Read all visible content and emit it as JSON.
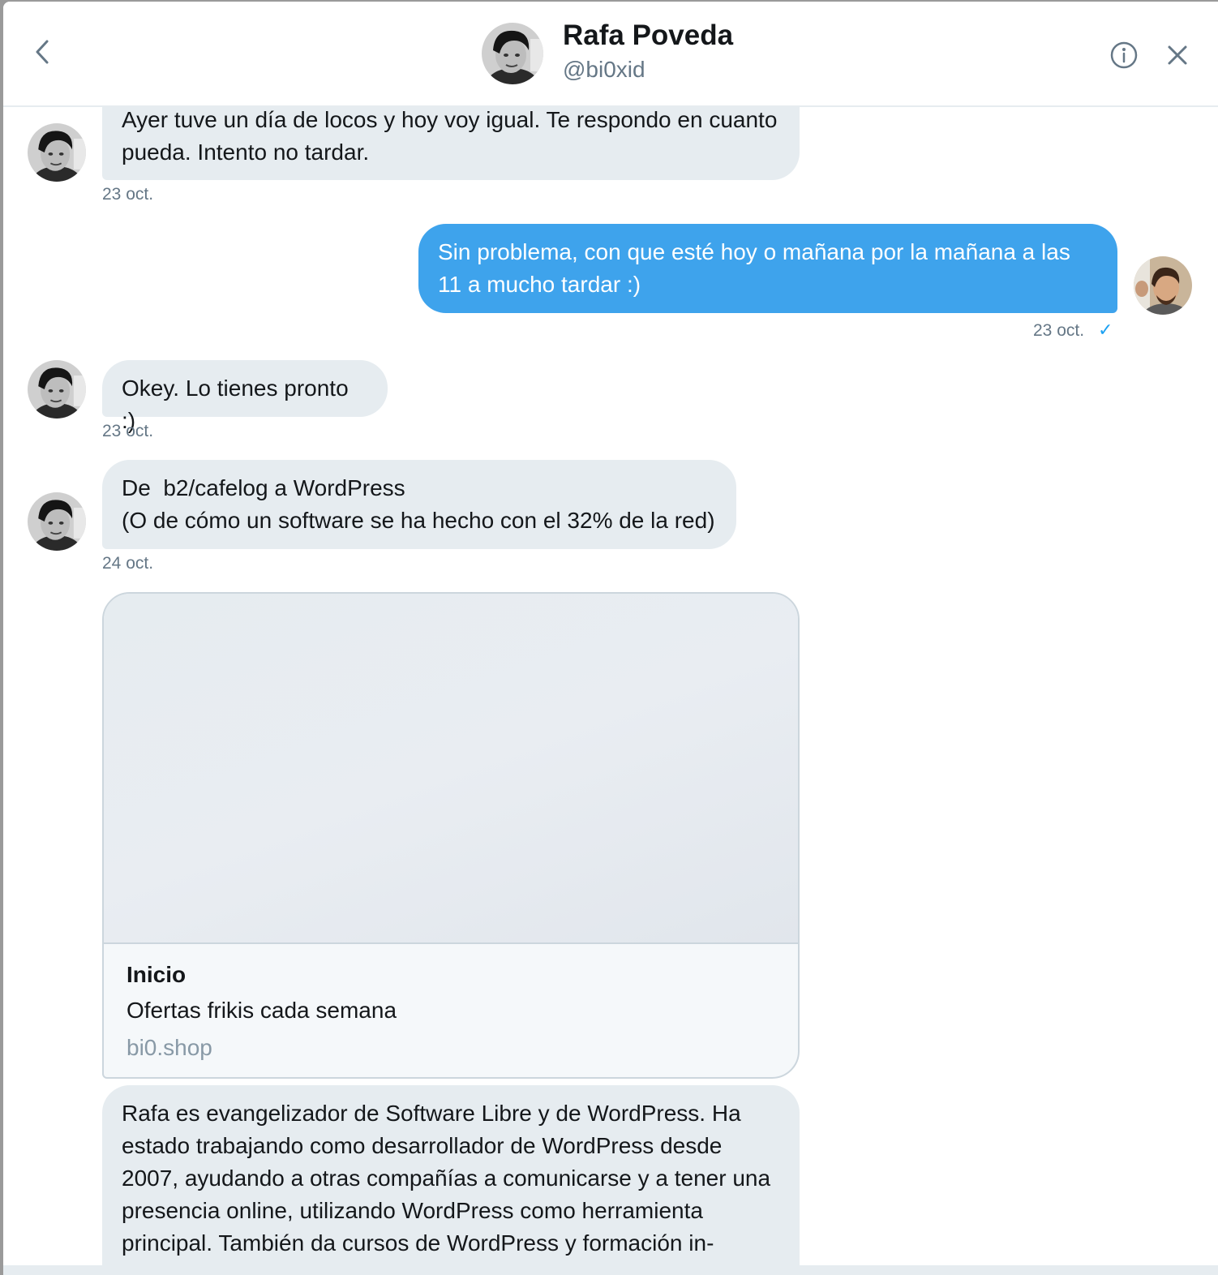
{
  "header": {
    "name": "Rafa Poveda",
    "handle": "@bi0xid",
    "back_icon": "chevron-left-icon",
    "info_icon": "info-icon",
    "close_icon": "close-icon"
  },
  "messages": [
    {
      "direction": "received",
      "lines": [
        "Ayer tuve un día de locos y hoy voy igual. Te respondo en cuanto",
        "pueda. Intento no tardar."
      ],
      "timestamp": "23 oct."
    },
    {
      "direction": "sent",
      "lines": [
        "Sin problema, con que esté hoy o mañana por la mañana a las",
        "11 a mucho tardar :)"
      ],
      "timestamp": "23 oct.",
      "status": "✓"
    },
    {
      "direction": "received",
      "lines": [
        "Okey. Lo tienes pronto :)"
      ],
      "timestamp": "23 oct."
    },
    {
      "direction": "received",
      "lines": [
        "De  b2/cafelog a WordPress",
        "(O de cómo un software se ha hecho con el 32% de la red)"
      ],
      "timestamp": "24 oct."
    },
    {
      "direction": "received",
      "type": "link-card",
      "card": {
        "title": "Inicio",
        "description": "Ofertas frikis cada semana",
        "domain": "bi0.shop"
      }
    },
    {
      "direction": "received",
      "lines": [
        "Rafa es evangelizador de Software Libre y de WordPress. Ha",
        "estado trabajando como desarrollador de WordPress desde",
        "2007, ayudando a otras compañías a comunicarse y a tener una",
        "presencia online, utilizando WordPress como herramienta",
        "principal. También da cursos de WordPress y formación in-"
      ]
    }
  ],
  "colors": {
    "sent_bubble": "#3ea3ec",
    "received_bubble": "#e6ecf0",
    "accent": "#1da1f2",
    "muted_text": "#657786"
  }
}
